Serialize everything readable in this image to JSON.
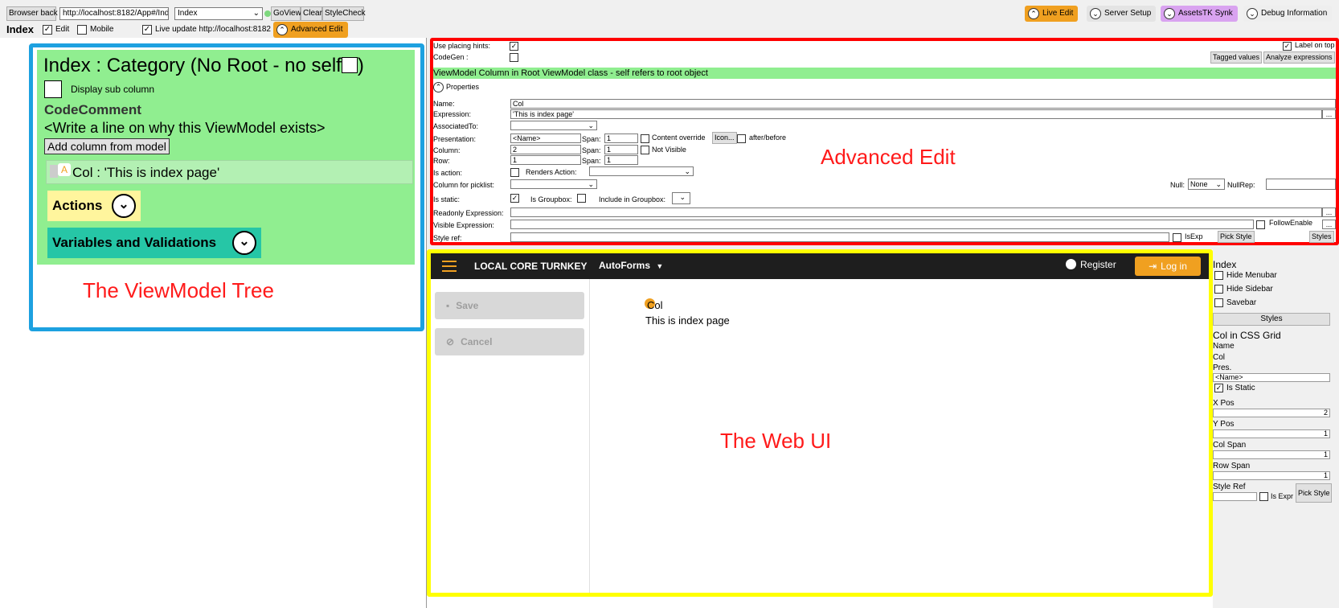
{
  "toolbar": {
    "browser_back": "Browser back",
    "url": "http://localhost:8182/App#/Ind",
    "viewmodel_select": "Index",
    "goview": "GoView",
    "clear": "Clear",
    "stylecheck": "StyleCheck",
    "pills": {
      "live_edit": "Live Edit",
      "server_setup": "Server Setup",
      "assets_synk": "AssetsTK Synk",
      "debug_info": "Debug Information"
    },
    "index_label": "Index",
    "edit_label": "Edit",
    "mobile_label": "Mobile",
    "live_update_label": "Live update http://localhost:8182",
    "advanced_edit_btn": "Advanced Edit",
    "colors": {
      "orange": "#f0a020",
      "purple": "#d9a3f0",
      "green_dot": "#7ed87e"
    }
  },
  "tree": {
    "title": "Index : Category  (No Root - no self",
    "title_close": ")",
    "display_sub_column": "Display sub column",
    "code_comment": "CodeComment",
    "comment_hint": "<Write a line on why this ViewModel exists>",
    "add_column_btn": "Add column from model",
    "col_item": "Col : 'This is index page'",
    "actions": "Actions",
    "variables": "Variables and Validations",
    "colors": {
      "bg": "#90ee90",
      "border": "#1da1e0",
      "actions_bg": "#fff59d",
      "variables_bg": "#26c6a6"
    }
  },
  "advanced": {
    "use_placing_hints": "Use placing hints:",
    "codegen": "CodeGen :",
    "label_on_top": "Label on top",
    "tagged_values": "Tagged values",
    "analyze_expressions": "Analyze expressions",
    "banner": "ViewModel Column in Root ViewModel class - self refers to root object",
    "properties": "Properties",
    "name_label": "Name:",
    "name_value": "Col",
    "expression_label": "Expression:",
    "expression_value": "'This is index page'",
    "associated_label": "AssociatedTo:",
    "presentation_label": "Presentation:",
    "presentation_value": "<Name>",
    "span_label": "Span:",
    "span1": "1",
    "content_override": "Content override",
    "icon_btn": "Icon...",
    "after_before": "after/before",
    "column_label": "Column:",
    "column_value": "2",
    "span2": "1",
    "not_visible": "Not Visible",
    "row_label": "Row:",
    "row_value": "1",
    "span3": "1",
    "is_action": "Is action:",
    "renders_action": "Renders Action:",
    "column_for_picklist": "Column for picklist:",
    "null_label": "Null:",
    "null_value": "None",
    "nullrep_label": "NullRep:",
    "is_static": "Is static:",
    "is_groupbox": "Is Groupbox:",
    "include_groupbox": "Include in Groupbox:",
    "readonly_expr": "Readonly Expression:",
    "visible_expr": "Visible Expression:",
    "follow_enable": "FollowEnable",
    "style_ref": "Style ref:",
    "isexp": "IsExp",
    "pick_style": "Pick Style",
    "styles": "Styles",
    "ellipsis": "...",
    "colors": {
      "border": "#ff0000",
      "banner": "#90ee90"
    }
  },
  "webui": {
    "brand": "LOCAL CORE TURNKEY",
    "autoforms": "AutoForms",
    "register": "Register",
    "login": "Log in",
    "save": "Save",
    "cancel": "Cancel",
    "col_label": "Col",
    "col_value": "This is index page",
    "colors": {
      "nav": "#1e1e1e",
      "login": "#f0a020",
      "border": "#ffff00"
    }
  },
  "side": {
    "index": "Index",
    "hide_menubar": "Hide Menubar",
    "hide_sidebar": "Hide Sidebar",
    "savebar": "Savebar",
    "styles_btn": "Styles",
    "col_in_grid": "Col in CSS Grid",
    "name_label": "Name",
    "name_value": "Col",
    "pres_label": "Pres.",
    "pres_value": "<Name>",
    "is_static": "Is Static",
    "xpos_label": "X Pos",
    "xpos_value": "2",
    "ypos_label": "Y Pos",
    "ypos_value": "1",
    "colspan_label": "Col Span",
    "colspan_value": "1",
    "rowspan_label": "Row Span",
    "rowspan_value": "1",
    "styleref_label": "Style Ref",
    "is_expr": "Is Expr",
    "pick_style": "Pick Style"
  },
  "annotations": {
    "tree": "The ViewModel Tree",
    "advanced": "Advanced Edit",
    "webui": "The Web UI"
  }
}
